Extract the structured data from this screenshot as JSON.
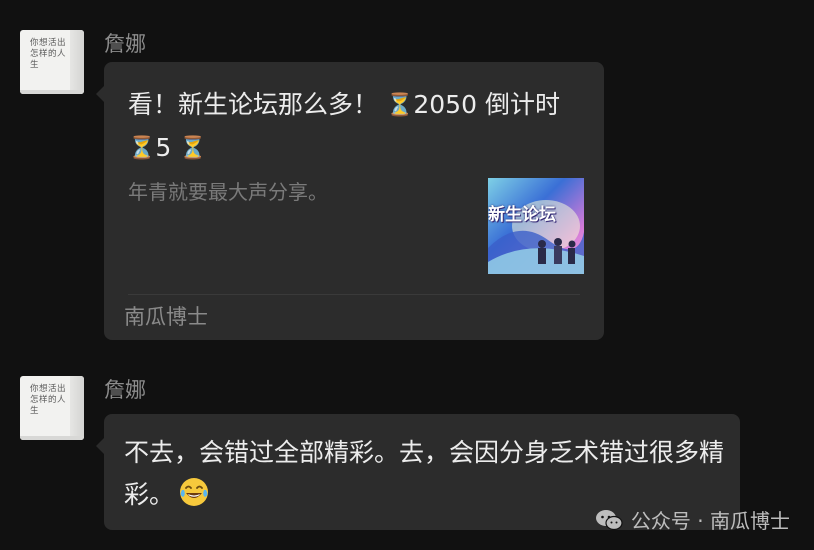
{
  "messages": [
    {
      "sender": "詹娜",
      "avatar": {
        "book_title_line1": "你想活出",
        "book_title_line2": "怎样的人生"
      },
      "card": {
        "title_part1": "看！新生论坛那么多！",
        "title_part2": "2050 倒计时",
        "title_part3": "5",
        "hourglass_icon": "hourglass-emoji",
        "description": "年青就要最大声分享。",
        "thumbnail_title": "新生论坛",
        "source": "南瓜博士"
      }
    },
    {
      "sender": "詹娜",
      "avatar": {
        "book_title_line1": "你想活出",
        "book_title_line2": "怎样的人生"
      },
      "text": "不去，会错过全部精彩。去，会因分身乏术错过很多精彩。",
      "emoji": "tears-of-joy-emoji"
    }
  ],
  "watermark": {
    "icon": "wechat-icon",
    "label": "公众号 · 南瓜博士"
  },
  "colors": {
    "background": "#111111",
    "bubble": "#2c2c2c",
    "name_text": "#8d8d8d"
  }
}
